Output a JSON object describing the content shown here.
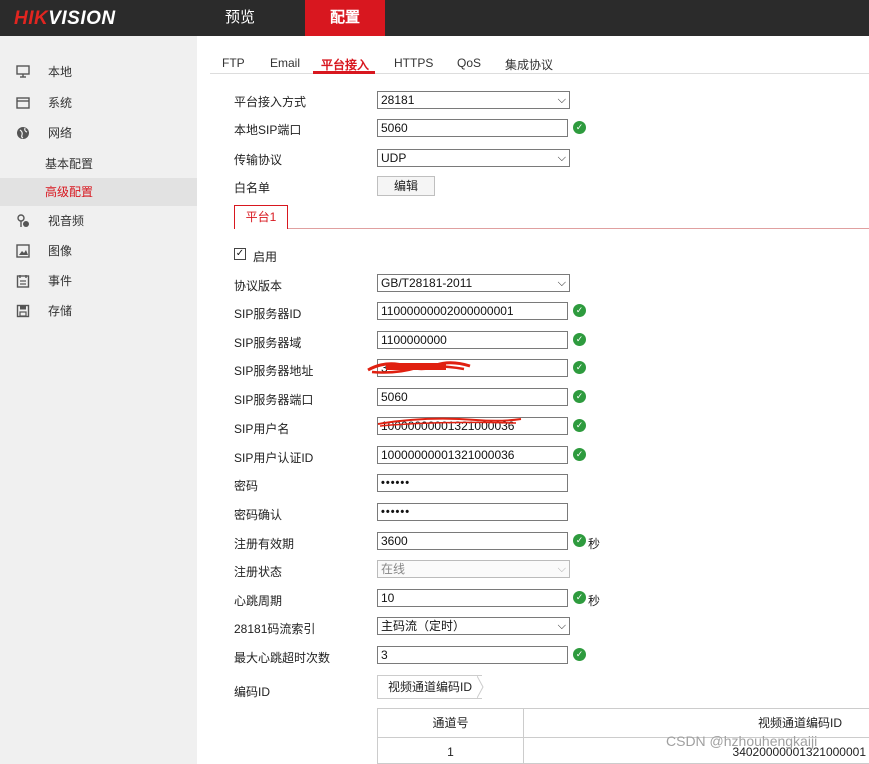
{
  "header": {
    "logo_hik": "HIK",
    "logo_rest": "VISION",
    "nav": [
      "预览",
      "配置"
    ],
    "accent": "#d8171f"
  },
  "sidebar": {
    "items": [
      "本地",
      "系统",
      "网络",
      "视音频",
      "图像",
      "事件",
      "存储"
    ],
    "network_sub": [
      "基本配置",
      "高级配置"
    ]
  },
  "tabs": [
    "FTP",
    "Email",
    "平台接入",
    "HTTPS",
    "QoS",
    "集成协议"
  ],
  "form": {
    "access_mode_label": "平台接入方式",
    "access_mode_value": "28181",
    "sip_port_label": "本地SIP端口",
    "sip_port_value": "5060",
    "transport_label": "传输协议",
    "transport_value": "UDP",
    "whitelist_label": "白名单",
    "whitelist_button": "编辑"
  },
  "platform_tab": "平台1",
  "platform": {
    "enable_label": "启用",
    "protocol_label": "协议版本",
    "protocol_value": "GB/T28181-2011",
    "server_id_label": "SIP服务器ID",
    "server_id_value": "11000000002000000001",
    "server_domain_label": "SIP服务器域",
    "server_domain_value": "1100000000",
    "server_addr_label": "SIP服务器地址",
    "server_addr_value": "3",
    "server_port_label": "SIP服务器端口",
    "server_port_value": "5060",
    "username_label": "SIP用户名",
    "username_value": "10000000001321000036",
    "auth_id_label": "SIP用户认证ID",
    "auth_id_value": "10000000001321000036",
    "password_label": "密码",
    "password_value": "••••••",
    "password_confirm_label": "密码确认",
    "password_confirm_value": "••••••",
    "expiry_label": "注册有效期",
    "expiry_value": "3600",
    "expiry_unit": "秒",
    "status_label": "注册状态",
    "status_value": "在线",
    "heartbeat_label": "心跳周期",
    "heartbeat_value": "10",
    "heartbeat_unit": "秒",
    "stream_label": "28181码流索引",
    "stream_value": "主码流（定时）",
    "max_timeout_label": "最大心跳超时次数",
    "max_timeout_value": "3",
    "encode_id_label": "编码ID"
  },
  "encode": {
    "tab": "视频通道编码ID",
    "columns": [
      "通道号",
      "视频通道编码ID"
    ],
    "rows": [
      [
        "1",
        "34020000001321000001"
      ]
    ]
  },
  "watermark": "CSDN @hzhouhengkaiji",
  "colors": {
    "ok_green": "#2e9b3e",
    "topbar": "#2b2b2b",
    "sidebar": "#f0f0f0"
  }
}
